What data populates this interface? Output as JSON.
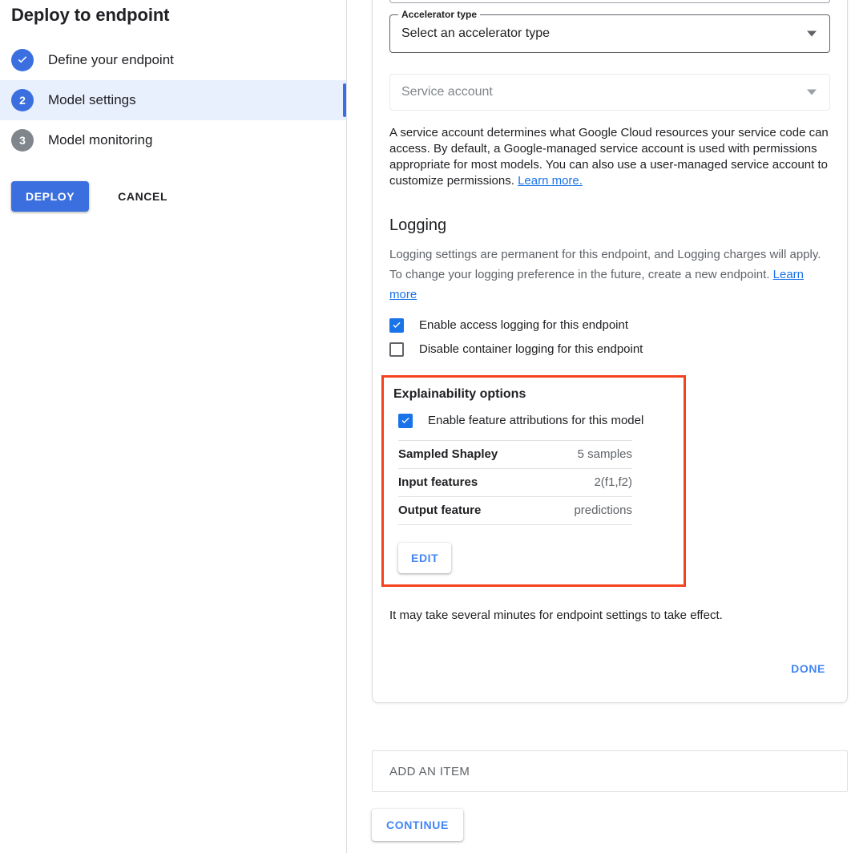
{
  "sidebar": {
    "title": "Deploy to endpoint",
    "steps": [
      {
        "number": "1",
        "label": "Define your endpoint",
        "state": "done"
      },
      {
        "number": "2",
        "label": "Model settings",
        "state": "current"
      },
      {
        "number": "3",
        "label": "Model monitoring",
        "state": "todo"
      }
    ],
    "deploy_label": "DEPLOY",
    "cancel_label": "CANCEL"
  },
  "main": {
    "accelerator": {
      "legend": "Accelerator type",
      "value": "Select an accelerator type"
    },
    "service_account": {
      "placeholder": "Service account",
      "help_text": " A service account determines what Google Cloud resources your service code can access. By default, a Google-managed service account is used with permissions appropriate for most models. You can also use a user-managed service account to customize permissions. ",
      "help_link": "Learn more."
    },
    "logging": {
      "title": "Logging",
      "description": "Logging settings are permanent for this endpoint, and Logging charges will apply. To change your logging preference in the future, create a new endpoint. ",
      "link": "Learn more",
      "checkboxes": [
        {
          "label": "Enable access logging for this endpoint",
          "checked": true
        },
        {
          "label": "Disable container logging for this endpoint",
          "checked": false
        }
      ]
    },
    "explainability": {
      "title": "Explainability options",
      "enable_label": "Enable feature attributions for this model",
      "enable_checked": true,
      "rows": [
        {
          "key": "Sampled Shapley",
          "value": "5 samples"
        },
        {
          "key": "Input features",
          "value": "2(f1,f2)"
        },
        {
          "key": "Output feature",
          "value": "predictions"
        }
      ],
      "edit_label": "EDIT",
      "highlight_color": "#f4411e"
    },
    "notice": "It may take several minutes for endpoint settings to take effect.",
    "done_label": "DONE",
    "add_item_label": "ADD AN ITEM",
    "continue_label": "CONTINUE"
  },
  "colors": {
    "accent_blue": "#3b6fe0",
    "link_blue": "#1a73e8",
    "button_blue": "#4285f4",
    "highlight_red": "#f4411e",
    "active_row_bg": "#e8f0fe"
  }
}
